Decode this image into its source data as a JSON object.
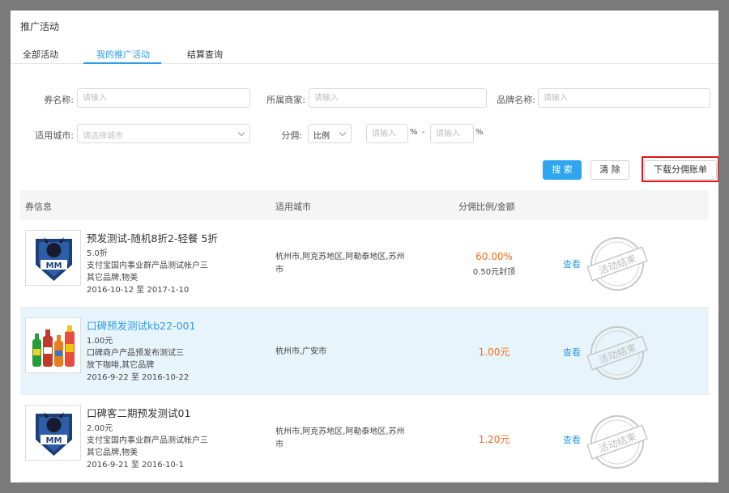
{
  "page": {
    "title": "推广活动"
  },
  "tabs": [
    {
      "label": "全部活动"
    },
    {
      "label": "我的推广活动"
    },
    {
      "label": "结算查询"
    }
  ],
  "filters": {
    "coupon_name": {
      "label": "券名称:",
      "placeholder": "请输入"
    },
    "merchant": {
      "label": "所属商家:",
      "placeholder": "请输入"
    },
    "brand": {
      "label": "品牌名称:",
      "placeholder": "请输入"
    },
    "city": {
      "label": "适用城市:",
      "placeholder": "请选择城市"
    },
    "commission": {
      "label": "分佣:",
      "type_value": "比例",
      "min_placeholder": "请输入",
      "max_placeholder": "请输入",
      "unit": "%",
      "separator": "-"
    }
  },
  "buttons": {
    "search": "搜 索",
    "clear": "清 除",
    "download": "下载分佣账单"
  },
  "table": {
    "headers": [
      "券信息",
      "适用城市",
      "分佣比例/金额"
    ],
    "rows": [
      {
        "title": "预发测试-随机8折2-轻餐 5折",
        "price": "5.0折",
        "merchant": "支付宝国内事业群产品测试帐户三",
        "brand": "其它品牌,物美",
        "date": "2016-10-12 至 2017-1-10",
        "city_line1": "杭州市,阿克苏地区,阿勒泰地区,苏州",
        "city_line2": "市",
        "rate": "60.00%",
        "cap": "0.50元封顶",
        "action": "查看",
        "stamp": "活动结束",
        "image": "logo-icon",
        "highlighted": false
      },
      {
        "title": "口碑预发测试kb22-001",
        "price": "1.00元",
        "merchant": "口碑商户产品预发布测试三",
        "brand": "放下咖啡,其它品牌",
        "date": "2016-9-22 至 2016-10-22",
        "city_line1": "杭州市,广安市",
        "city_line2": "",
        "rate": "1.00元",
        "cap": "",
        "action": "查看",
        "stamp": "活动结束",
        "image": "bottles-icon",
        "highlighted": true
      },
      {
        "title": "口碑客二期预发测试01",
        "price": "2.00元",
        "merchant": "支付宝国内事业群产品测试帐户三",
        "brand": "其它品牌,物美",
        "date": "2016-9-21 至 2016-10-1",
        "city_line1": "杭州市,阿克苏地区,阿勒泰地区,苏州",
        "city_line2": "市",
        "rate": "1.20元",
        "cap": "",
        "action": "查看",
        "stamp": "活动结束",
        "image": "logo-icon",
        "highlighted": false
      }
    ]
  },
  "colors": {
    "accent": "#2f9ce8",
    "primary_button": "#2fa4ef",
    "rate": "#f56c1e",
    "highlight_row": "#e8f4fb",
    "annotation_box": "#e0141e",
    "stamp": "#c8c8c8"
  }
}
